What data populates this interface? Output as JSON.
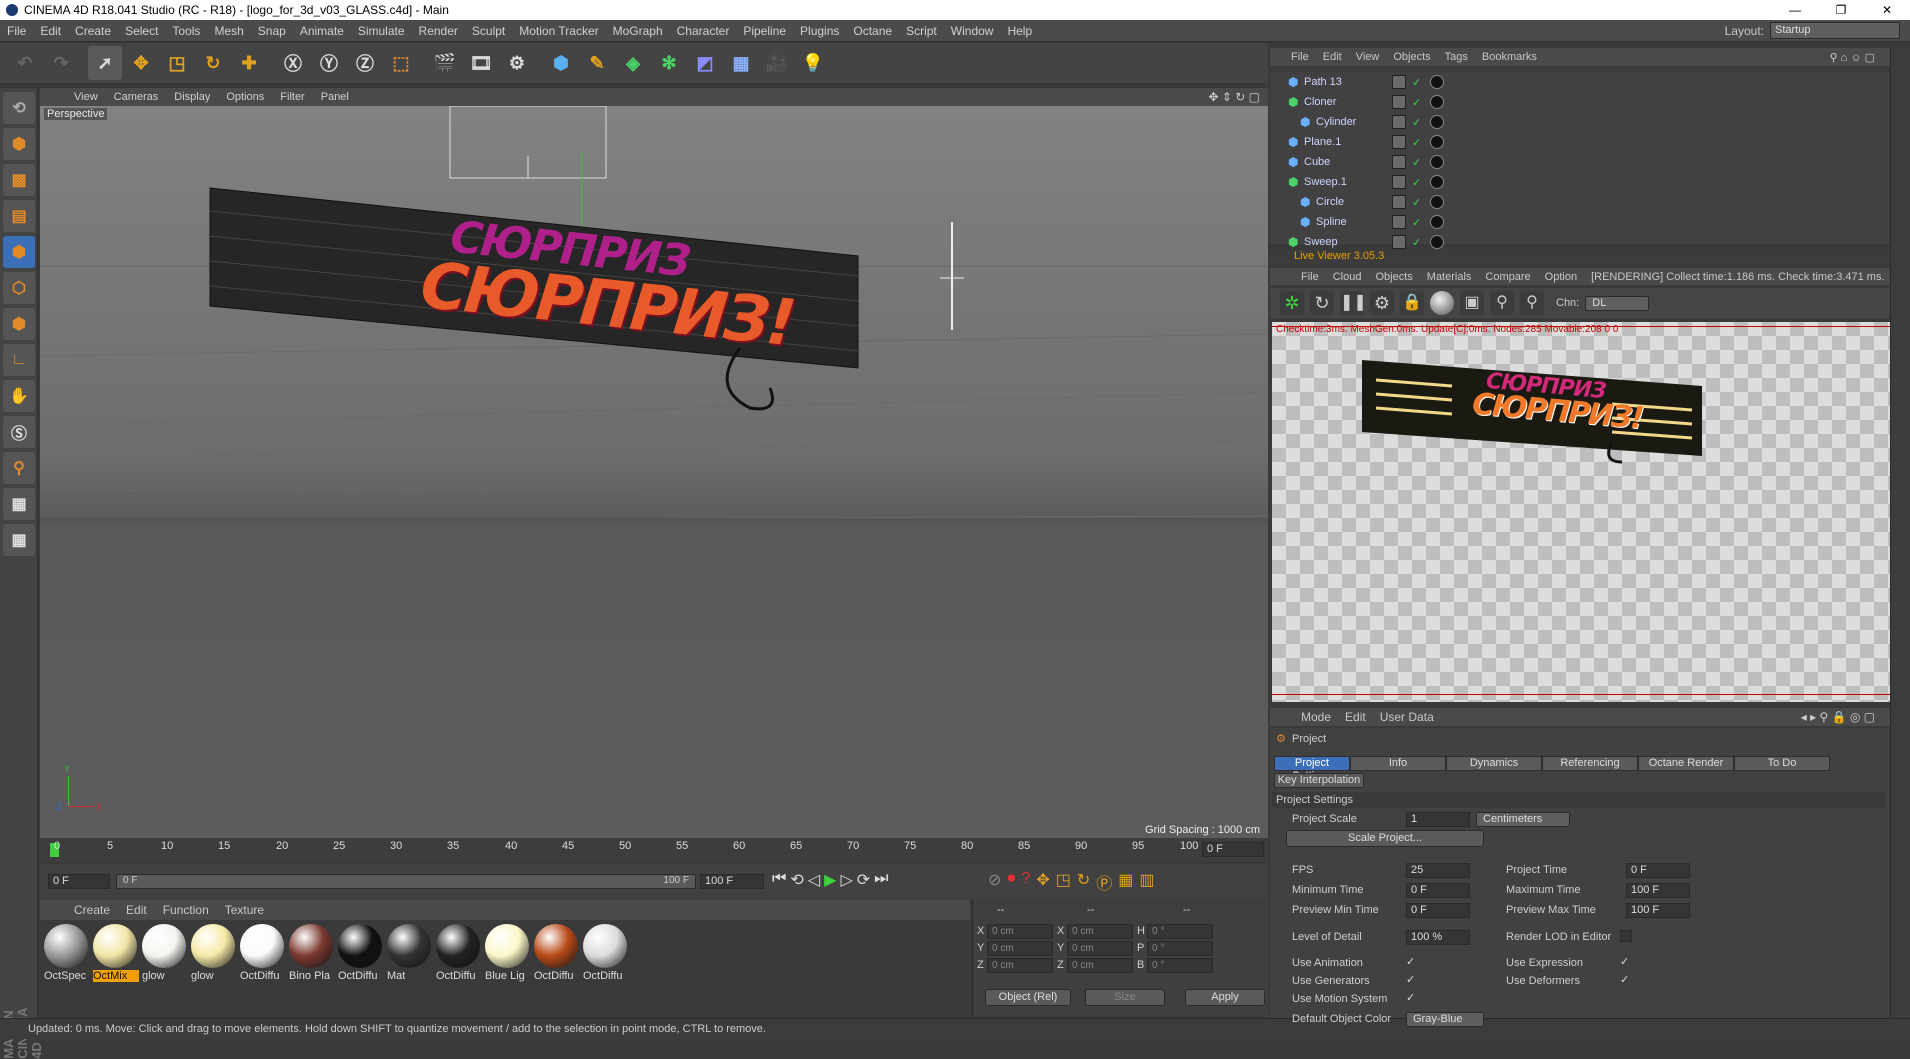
{
  "window": {
    "title": "CINEMA 4D R18.041 Studio (RC - R18) - [logo_for_3d_v03_GLASS.c4d] - Main",
    "min": "—",
    "restore": "❐",
    "close": "✕"
  },
  "menu": [
    "File",
    "Edit",
    "Create",
    "Select",
    "Tools",
    "Mesh",
    "Snap",
    "Animate",
    "Simulate",
    "Render",
    "Sculpt",
    "Motion Tracker",
    "MoGraph",
    "Character",
    "Pipeline",
    "Plugins",
    "Octane",
    "Script",
    "Window",
    "Help"
  ],
  "layout": {
    "label": "Layout:",
    "value": "Startup"
  },
  "viewport": {
    "menu": [
      "View",
      "Cameras",
      "Display",
      "Options",
      "Filter",
      "Panel"
    ],
    "camera": "Perspective",
    "grid_spacing": "Grid Spacing : 1000 cm",
    "sign_line1": "СЮРПРИЗ",
    "sign_line2": "СЮРПРИЗ!",
    "axes": {
      "y": "Y",
      "z": "Z",
      "x": "X"
    }
  },
  "timeline": {
    "ticks": [
      "0",
      "5",
      "10",
      "15",
      "20",
      "25",
      "30",
      "35",
      "40",
      "45",
      "50",
      "55",
      "60",
      "65",
      "70",
      "75",
      "80",
      "85",
      "90",
      "95",
      "100"
    ],
    "current": "0 F",
    "start": "0 F",
    "range_start": "0 F",
    "range_end": "100 F",
    "end": "100 F"
  },
  "materials": {
    "menu": [
      "Create",
      "Edit",
      "Function",
      "Texture"
    ],
    "items": [
      {
        "label": "OctSpec",
        "color": "#9a9a9a"
      },
      {
        "label": "OctMix",
        "color": "#f2e6a6"
      },
      {
        "label": "glow",
        "color": "#f4f4f0"
      },
      {
        "label": "glow",
        "color": "#f6eaa8"
      },
      {
        "label": "OctDiffu",
        "color": "#fafafa"
      },
      {
        "label": "Bino Pla",
        "color": "#7a3a30"
      },
      {
        "label": "OctDiffu",
        "color": "#111111"
      },
      {
        "label": "Mat",
        "color": "#333333"
      },
      {
        "label": "OctDiffu",
        "color": "#222222"
      },
      {
        "label": "Blue Lig",
        "color": "#fbf7c8"
      },
      {
        "label": "OctDiffu",
        "color": "#b84a18"
      },
      {
        "label": "OctDiffu",
        "color": "#dcdcdc"
      }
    ]
  },
  "coords": {
    "headers": [
      "--",
      "--",
      "--"
    ],
    "rows": [
      {
        "a": "X",
        "v1": "0 cm",
        "b": "X",
        "v2": "0 cm",
        "c": "H",
        "v3": "0 °"
      },
      {
        "a": "Y",
        "v1": "0 cm",
        "b": "Y",
        "v2": "0 cm",
        "c": "P",
        "v3": "0 °"
      },
      {
        "a": "Z",
        "v1": "0 cm",
        "b": "Z",
        "v2": "0 cm",
        "c": "B",
        "v3": "0 °"
      }
    ],
    "mode": "Object (Rel)",
    "size": "Size",
    "apply": "Apply"
  },
  "status": "Updated: 0 ms.   Move: Click and drag to move elements. Hold down SHIFT to quantize movement / add to the selection in point mode, CTRL to remove.",
  "objects": {
    "menu": [
      "File",
      "Edit",
      "View",
      "Objects",
      "Tags",
      "Bookmarks"
    ],
    "rows": [
      {
        "name": "Path 13",
        "indent": 0,
        "icon": "#6ab0ff"
      },
      {
        "name": "Cloner",
        "indent": 0,
        "icon": "#4bd36a"
      },
      {
        "name": "Cylinder",
        "indent": 1,
        "icon": "#6ab0ff"
      },
      {
        "name": "Plane.1",
        "indent": 0,
        "icon": "#6ab0ff"
      },
      {
        "name": "Cube",
        "indent": 0,
        "icon": "#6ab0ff"
      },
      {
        "name": "Sweep.1",
        "indent": 0,
        "icon": "#4bd36a"
      },
      {
        "name": "Circle",
        "indent": 1,
        "icon": "#6ab0ff"
      },
      {
        "name": "Spline",
        "indent": 1,
        "icon": "#6ab0ff"
      },
      {
        "name": "Sweep",
        "indent": 0,
        "icon": "#4bd36a"
      }
    ]
  },
  "live_viewer": {
    "title": "Live Viewer 3.05.3",
    "menu": [
      "File",
      "Cloud",
      "Objects",
      "Materials",
      "Compare",
      "Option"
    ],
    "status": "[RENDERING] Collect time:1.186 ms.  Check time:3.471 ms.",
    "chn_label": "Chn:",
    "chn_value": "DL",
    "info": "Checktime:3ms. MeshGen:0ms. Update[C]:0ms. Nodes:285 Movable:208  0 0",
    "sign_line1": "СЮРПРИЗ",
    "sign_line2": "СЮРПРИЗ!"
  },
  "attributes": {
    "menu": [
      "Mode",
      "Edit",
      "User Data"
    ],
    "object": "Project",
    "tabs": [
      "Project Settings",
      "Info",
      "Dynamics",
      "Referencing",
      "Octane Render",
      "To Do"
    ],
    "tab2": "Key Interpolation",
    "section": "Project Settings",
    "project_scale_label": "Project Scale",
    "project_scale_value": "1",
    "project_scale_unit": "Centimeters",
    "scale_button": "Scale Project...",
    "fps_label": "FPS",
    "fps_value": "25",
    "project_time_label": "Project Time",
    "project_time_value": "0 F",
    "min_time_label": "Minimum Time",
    "min_time_value": "0 F",
    "max_time_label": "Maximum Time",
    "max_time_value": "100 F",
    "prev_min_label": "Preview Min Time",
    "prev_min_value": "0 F",
    "prev_max_label": "Preview Max Time",
    "prev_max_value": "100 F",
    "lod_label": "Level of Detail",
    "lod_value": "100 %",
    "render_lod_label": "Render LOD in Editor",
    "use_anim_label": "Use Animation",
    "use_expr_label": "Use Expression",
    "use_gen_label": "Use Generators",
    "use_def_label": "Use Deformers",
    "use_motion_label": "Use Motion System",
    "default_color_label": "Default Object Color",
    "default_color_value": "Gray-Blue",
    "check": "✓"
  },
  "colors": {
    "accent": "#3c6fb8",
    "rendering": "#e6a000",
    "sign_top": "#b0208a",
    "sign_bottom": "#e85a2a"
  }
}
